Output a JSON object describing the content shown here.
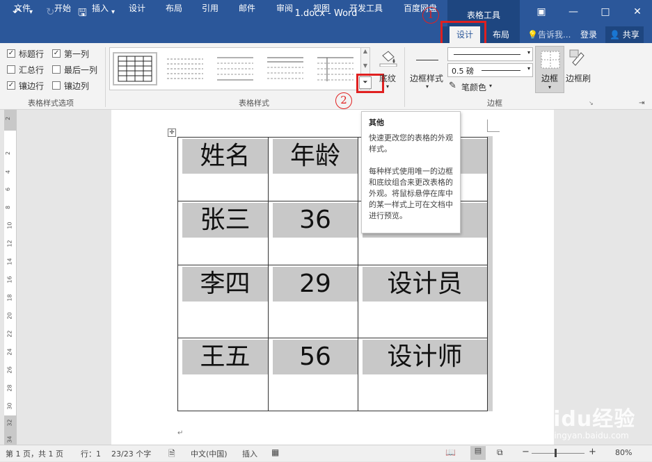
{
  "window": {
    "title": "1.docx - Word",
    "context_tab_group": "表格工具",
    "controls": {
      "ribbon_display": "▣",
      "minimize": "—",
      "maximize": "□",
      "close": "✕"
    }
  },
  "qat": {
    "undo": "↶",
    "undo_drop": "▾",
    "redo": "↻",
    "save": "🖫",
    "customize": "▾"
  },
  "tabs": [
    "文件",
    "开始",
    "插入",
    "设计",
    "布局",
    "引用",
    "邮件",
    "审阅",
    "视图",
    "开发工具",
    "百度网盘",
    "设计",
    "布局"
  ],
  "tell_me": "告诉我...",
  "signin": "登录",
  "share": "共享",
  "annotations": {
    "one": "1",
    "two": "2"
  },
  "style_options": {
    "items": [
      {
        "label": "标题行",
        "checked": true
      },
      {
        "label": "第一列",
        "checked": true
      },
      {
        "label": "汇总行",
        "checked": false
      },
      {
        "label": "最后一列",
        "checked": false
      },
      {
        "label": "镶边行",
        "checked": true
      },
      {
        "label": "镶边列",
        "checked": false
      }
    ],
    "group_label": "表格样式选项"
  },
  "table_styles": {
    "group_label": "表格样式",
    "shading": "底纹"
  },
  "borders": {
    "border_styles": "边框样式",
    "weight": "0.5 磅",
    "pen_color": "笔颜色",
    "borders_btn": "边框",
    "painter": "边框刷",
    "group_label": "边框"
  },
  "tooltip": {
    "title": "其他",
    "line1": "快速更改您的表格的外观样式。",
    "line2": "每种样式使用唯一的边框和底纹组合来更改表格的外观。将鼠标悬停在库中的某一样式上可在文档中进行预览。"
  },
  "document_table": {
    "rows": [
      [
        "姓名",
        "年龄",
        ""
      ],
      [
        "张三",
        "36",
        ""
      ],
      [
        "李四",
        "29",
        "设计员"
      ],
      [
        "王五",
        "56",
        "设计师"
      ]
    ]
  },
  "ruler_numbers": [
    "2",
    "2",
    "4",
    "6",
    "8",
    "10",
    "12",
    "14",
    "16",
    "18",
    "20",
    "22",
    "24",
    "26",
    "28",
    "30",
    "32",
    "34"
  ],
  "status": {
    "page": "第 1 页，共 1 页",
    "lines": "行：1",
    "chars": "23/23 个字",
    "language": "中文(中国)",
    "mode": "插入",
    "zoom": "80%"
  },
  "watermark": {
    "brand": "Baidu经验",
    "url": "jingyan.baidu.com"
  }
}
